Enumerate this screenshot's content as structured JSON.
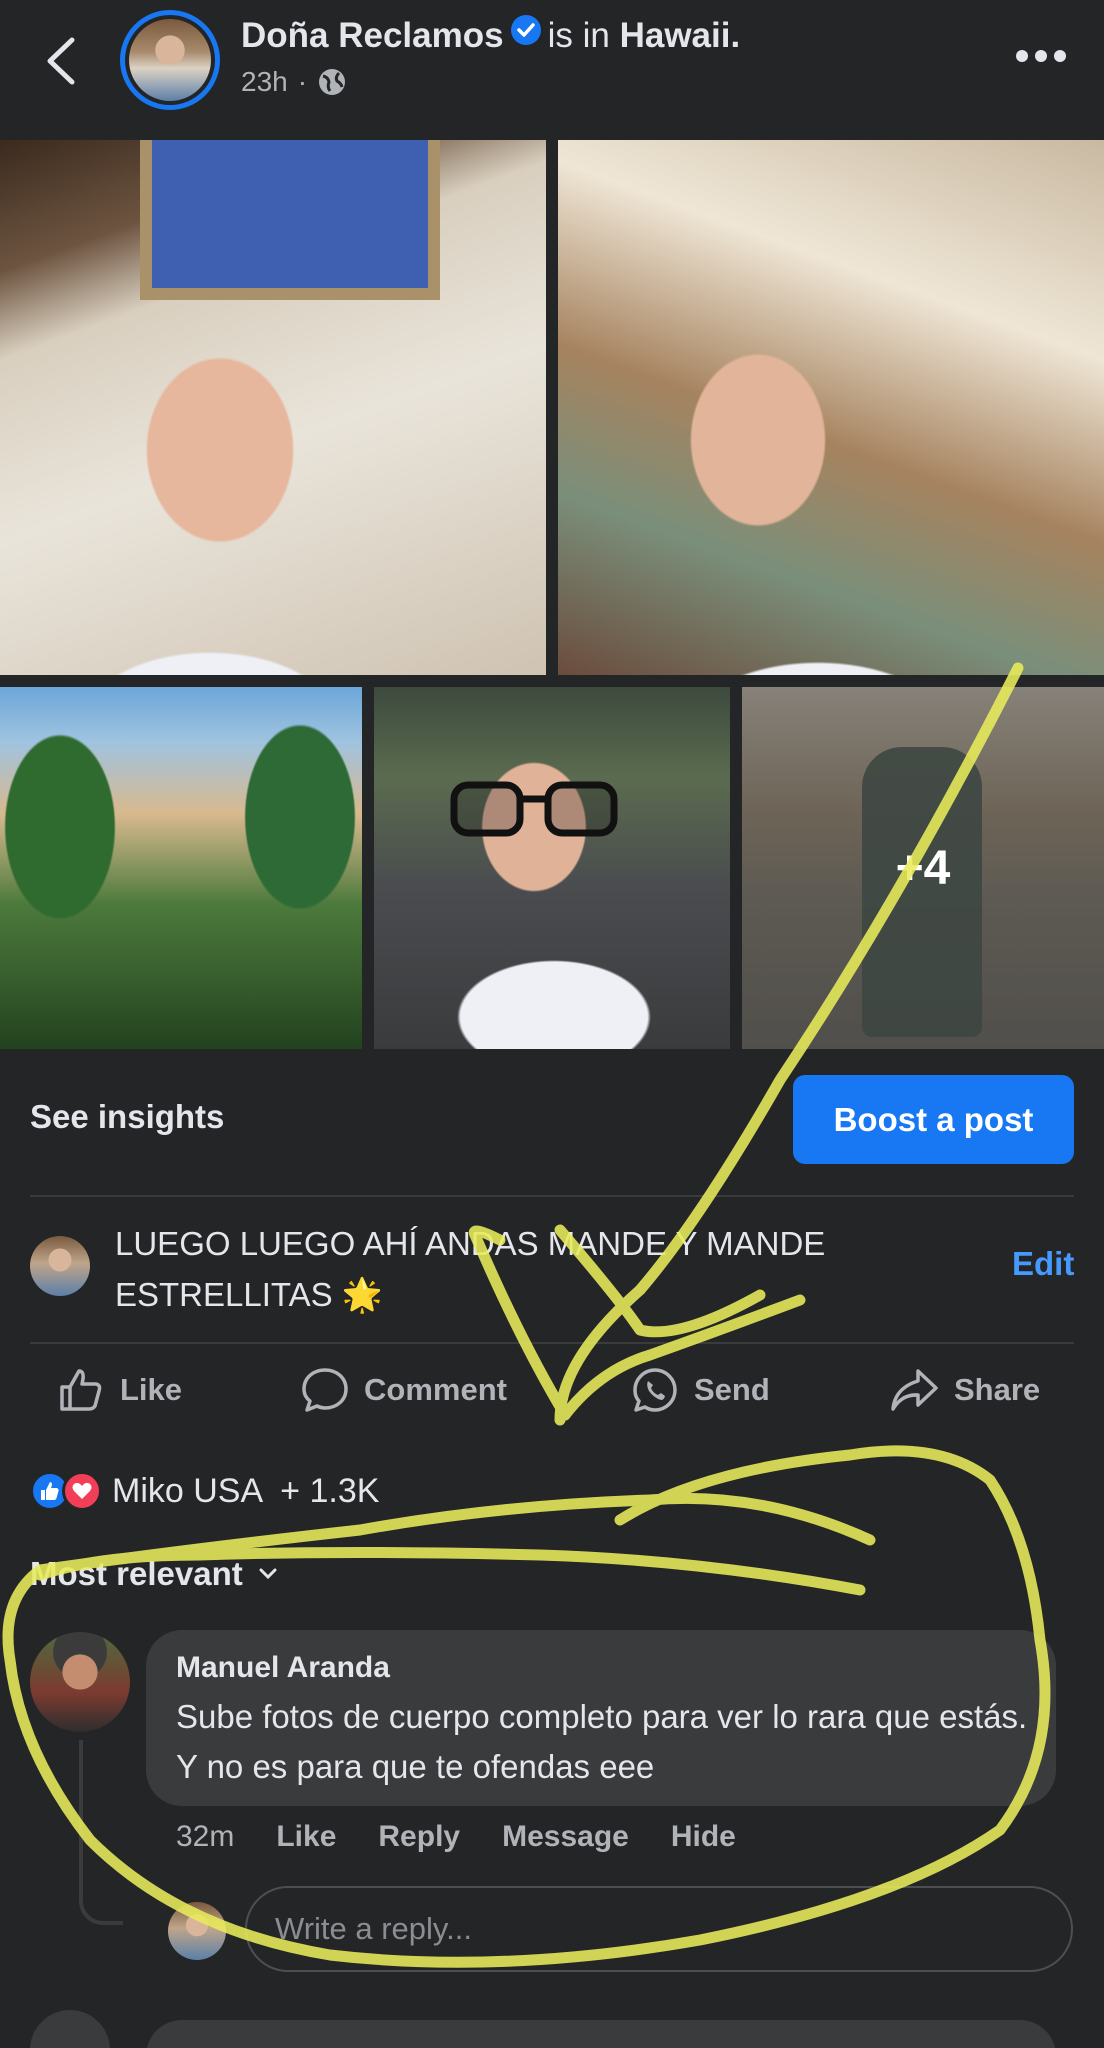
{
  "header": {
    "name": "Doña Reclamos",
    "status_text": "is in",
    "place": "Hawaii.",
    "time": "23h",
    "separator": "·",
    "verified_color": "#1877f2"
  },
  "photos": {
    "more_count": "+4"
  },
  "insights": {
    "label": "See insights",
    "boost_label": "Boost a post",
    "boost_color": "#1877f2"
  },
  "caption": {
    "text": "LUEGO LUEGO AHÍ ANDAS MANDE Y MANDE ESTRELLITAS 🌟",
    "edit_label": "Edit"
  },
  "actions": {
    "like": "Like",
    "comment": "Comment",
    "send": "Send",
    "share": "Share"
  },
  "reactions": {
    "text": "Miko USA  + 1.3K"
  },
  "sort": {
    "label": "Most relevant"
  },
  "comment": {
    "author": "Manuel Aranda",
    "body": "Sube fotos de cuerpo completo para ver lo rara que estás. Y no es para que te ofendas eee",
    "time": "32m",
    "like": "Like",
    "reply": "Reply",
    "message": "Message",
    "hide": "Hide"
  },
  "reply_box": {
    "placeholder": "Write a reply..."
  },
  "annotation": {
    "color": "#e8ec5a"
  }
}
